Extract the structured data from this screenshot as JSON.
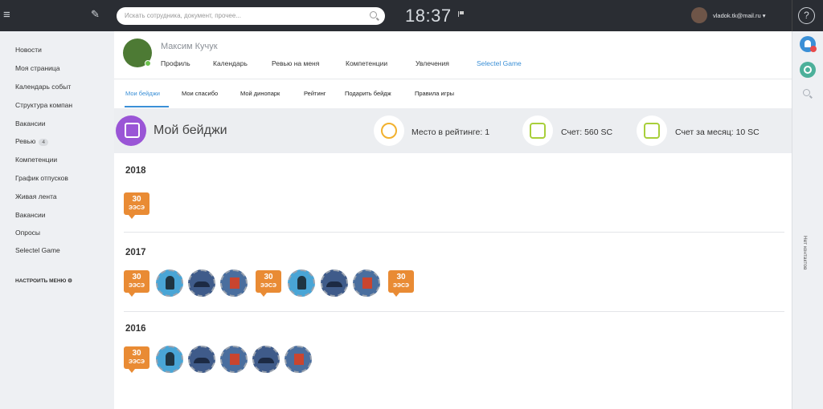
{
  "topbar": {
    "search_placeholder": "Искать сотрудника, документ, прочее...",
    "time": "18:37",
    "user_email": "vladok.tk@mail.ru",
    "help": "?"
  },
  "sidebar": {
    "items": [
      {
        "label": "Новости"
      },
      {
        "label": "Моя страница"
      },
      {
        "label": "Календарь событ"
      },
      {
        "label": "Структура компан"
      },
      {
        "label": "Вакансии"
      },
      {
        "label": "Ревью",
        "badge": "4"
      },
      {
        "label": "Компетенции"
      },
      {
        "label": "График отпусков"
      },
      {
        "label": "Живая лента"
      },
      {
        "label": "Вакансии"
      },
      {
        "label": "Опросы"
      },
      {
        "label": "Selectel Game"
      }
    ],
    "configure": "НАСТРОИТЬ МЕНЮ"
  },
  "profile": {
    "name": "Максим Кучук",
    "tabs": [
      {
        "label": "Профиль"
      },
      {
        "label": "Календарь"
      },
      {
        "label": "Ревью на меня"
      },
      {
        "label": "Компетенции"
      },
      {
        "label": "Увлечения"
      },
      {
        "label": "Selectel Game",
        "active": true
      }
    ]
  },
  "subtabs": [
    {
      "label": "Мои бейджи",
      "active": true
    },
    {
      "label": "Мои спасибо"
    },
    {
      "label": "Мой динопарк"
    },
    {
      "label": "Рейтинг"
    },
    {
      "label": "Подарить бейдж"
    },
    {
      "label": "Правила игры"
    }
  ],
  "banner": {
    "title": "Мой бейджи",
    "rating": "Место в рейтинге: 1",
    "score": "Счет: 560 SC",
    "month_score": "Счет за месяц: 10 SC"
  },
  "badge_text": {
    "number": "30",
    "label": "ЭЭСЭ"
  },
  "years": [
    {
      "year": "2018",
      "badges": [
        "30-days",
        "",
        "",
        "",
        "",
        "",
        "",
        "",
        ""
      ]
    },
    {
      "year": "2017"
    },
    {
      "year": "2016"
    }
  ],
  "rightbar": {
    "contacts": "Нет контактов"
  }
}
